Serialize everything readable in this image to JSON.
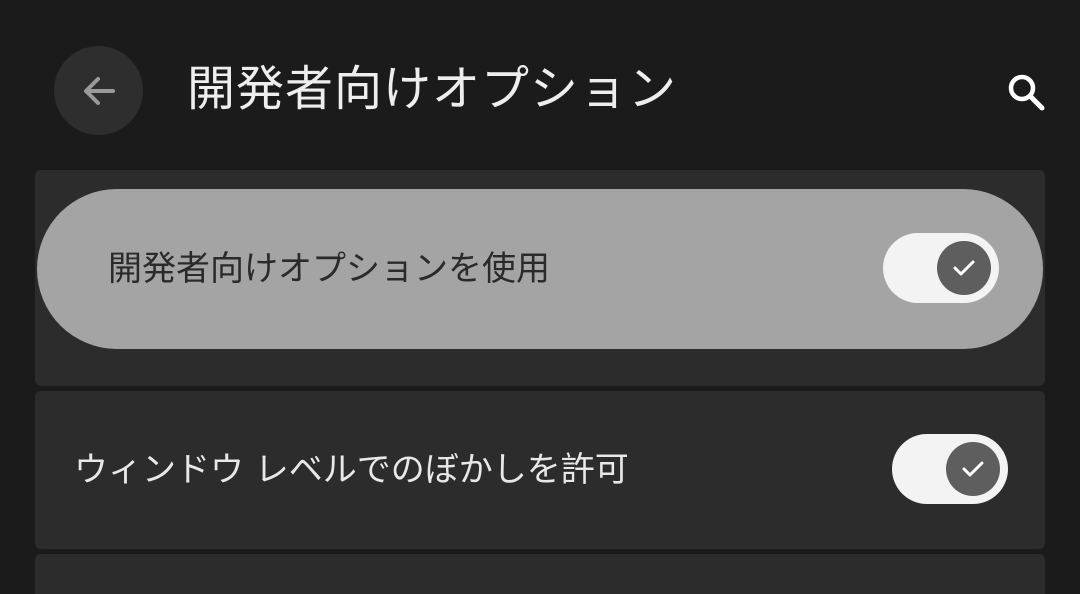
{
  "header": {
    "title": "開発者向けオプション",
    "back_icon": "arrow-back-icon",
    "search_icon": "search-icon"
  },
  "settings": [
    {
      "label": "開発者向けオプションを使用",
      "enabled": true,
      "highlighted": true
    },
    {
      "label": "ウィンドウ レベルでのぼかしを許可",
      "enabled": true,
      "highlighted": false
    }
  ],
  "colors": {
    "background": "#1b1b1b",
    "card": "#2c2c2c",
    "highlight": "#a4a4a4",
    "switch_track": "#f3f3f3",
    "switch_thumb": "#5e5e5e"
  }
}
